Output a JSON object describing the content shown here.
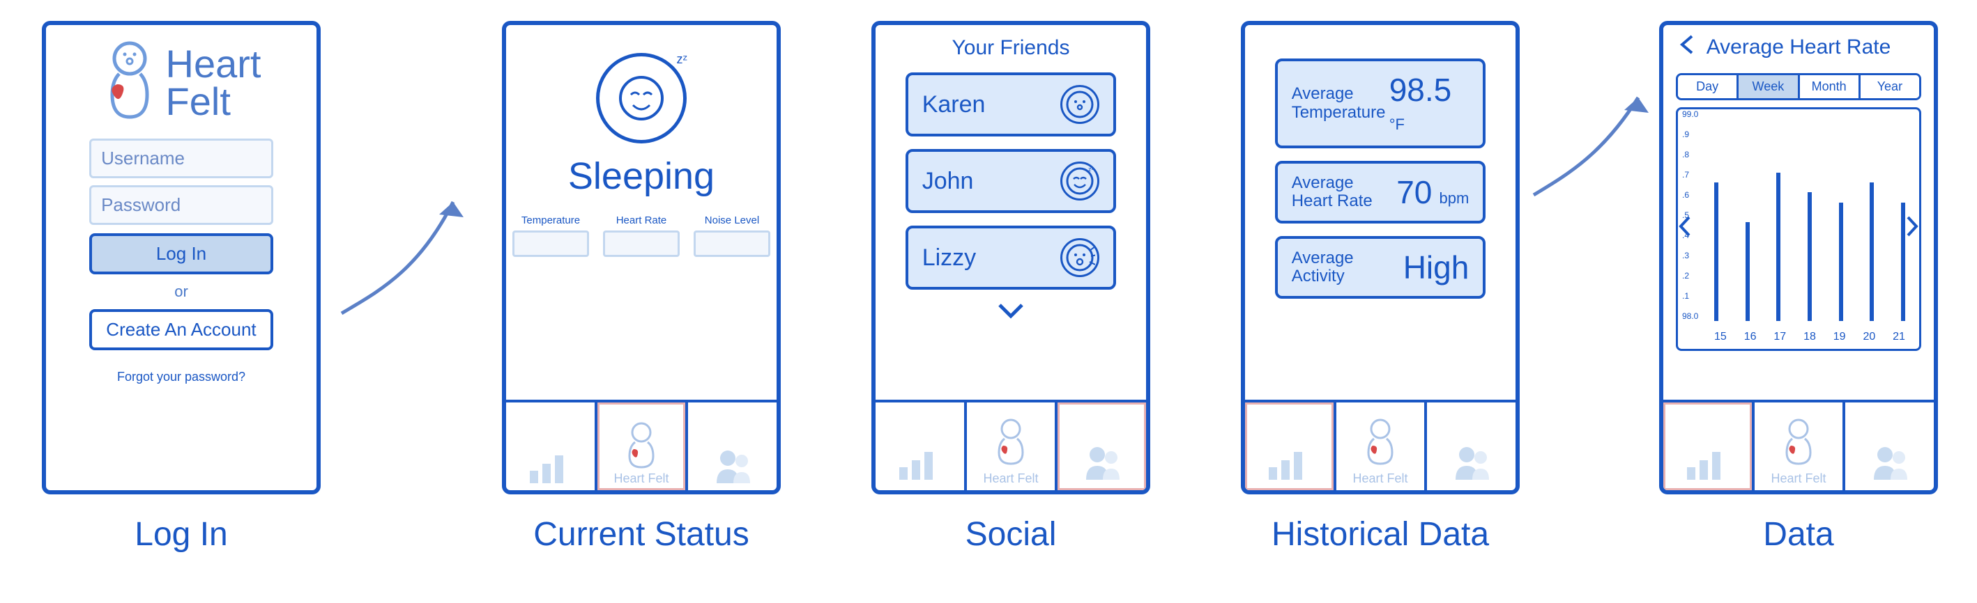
{
  "screens": {
    "login": {
      "brand_line1": "Heart",
      "brand_line2": "Felt",
      "username_placeholder": "Username",
      "password_placeholder": "Password",
      "login_button": "Log In",
      "or_text": "or",
      "create_button": "Create An Account",
      "forgot_text": "Forgot your password?"
    },
    "status": {
      "state_label": "Sleeping",
      "readouts": [
        {
          "label": "Temperature"
        },
        {
          "label": "Heart Rate"
        },
        {
          "label": "Noise Level"
        }
      ]
    },
    "social": {
      "title": "Your Friends",
      "friends": [
        {
          "name": "Karen",
          "status": "awake"
        },
        {
          "name": "John",
          "status": "sleeping"
        },
        {
          "name": "Lizzy",
          "status": "crying"
        }
      ]
    },
    "historical": {
      "cards": [
        {
          "label": "Average Temperature",
          "value": "98.5",
          "unit": "°F"
        },
        {
          "label": "Average Heart Rate",
          "value": "70",
          "unit": "bpm"
        },
        {
          "label": "Average Activity",
          "value": "High",
          "unit": ""
        }
      ]
    },
    "detail": {
      "title": "Average Heart Rate",
      "segments": [
        "Day",
        "Week",
        "Month",
        "Year"
      ],
      "active_segment": "Week"
    }
  },
  "tabbar": {
    "center_label": "Heart Felt"
  },
  "captions": {
    "login": "Log In",
    "status": "Current Status",
    "social": "Social",
    "historical": "Historical Data",
    "detail": "Data"
  },
  "chart_data": {
    "type": "bar",
    "title": "Average Heart Rate",
    "xlabel": "",
    "ylabel": "",
    "ylim": [
      98.0,
      99.0
    ],
    "yticks": [
      98.0,
      98.1,
      98.2,
      98.3,
      98.4,
      98.5,
      98.6,
      98.7,
      98.8,
      98.9,
      99.0
    ],
    "categories": [
      "15",
      "16",
      "17",
      "18",
      "19",
      "20",
      "21"
    ],
    "values": [
      98.7,
      98.5,
      98.75,
      98.65,
      98.6,
      98.7,
      98.6
    ]
  },
  "colors": {
    "blue": "#1a57c4",
    "blue_fill": "#c3d7ef"
  }
}
